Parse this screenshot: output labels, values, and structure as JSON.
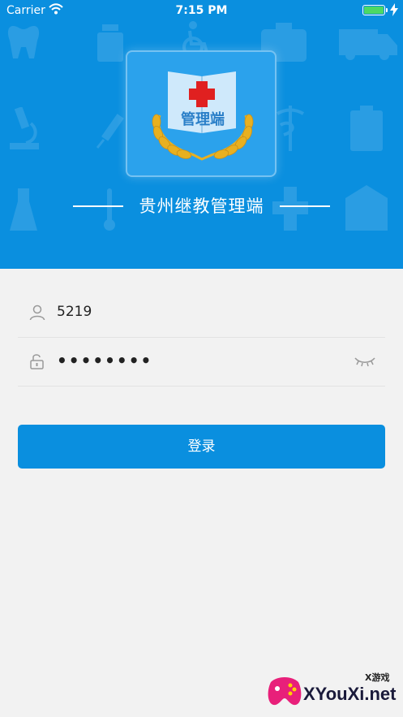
{
  "status_bar": {
    "carrier": "Carrier",
    "time": "7:15 PM"
  },
  "header": {
    "logo_text": "管理端",
    "app_title": "贵州继教管理端"
  },
  "form": {
    "username": {
      "value": "5219"
    },
    "password": {
      "masked_value": "••••••••"
    },
    "login_button": "登录"
  },
  "watermark": {
    "small_text": "X游戏",
    "big_text": "XYouXi.net"
  },
  "colors": {
    "primary": "#0a8fdf",
    "background": "#f2f2f2",
    "cross_red": "#e02020",
    "laurel_gold": "#e8b020"
  },
  "icons": [
    "wifi-icon",
    "battery-icon",
    "user-icon",
    "lock-icon",
    "eye-closed-icon",
    "medical-book-icon",
    "laurel-icon"
  ]
}
